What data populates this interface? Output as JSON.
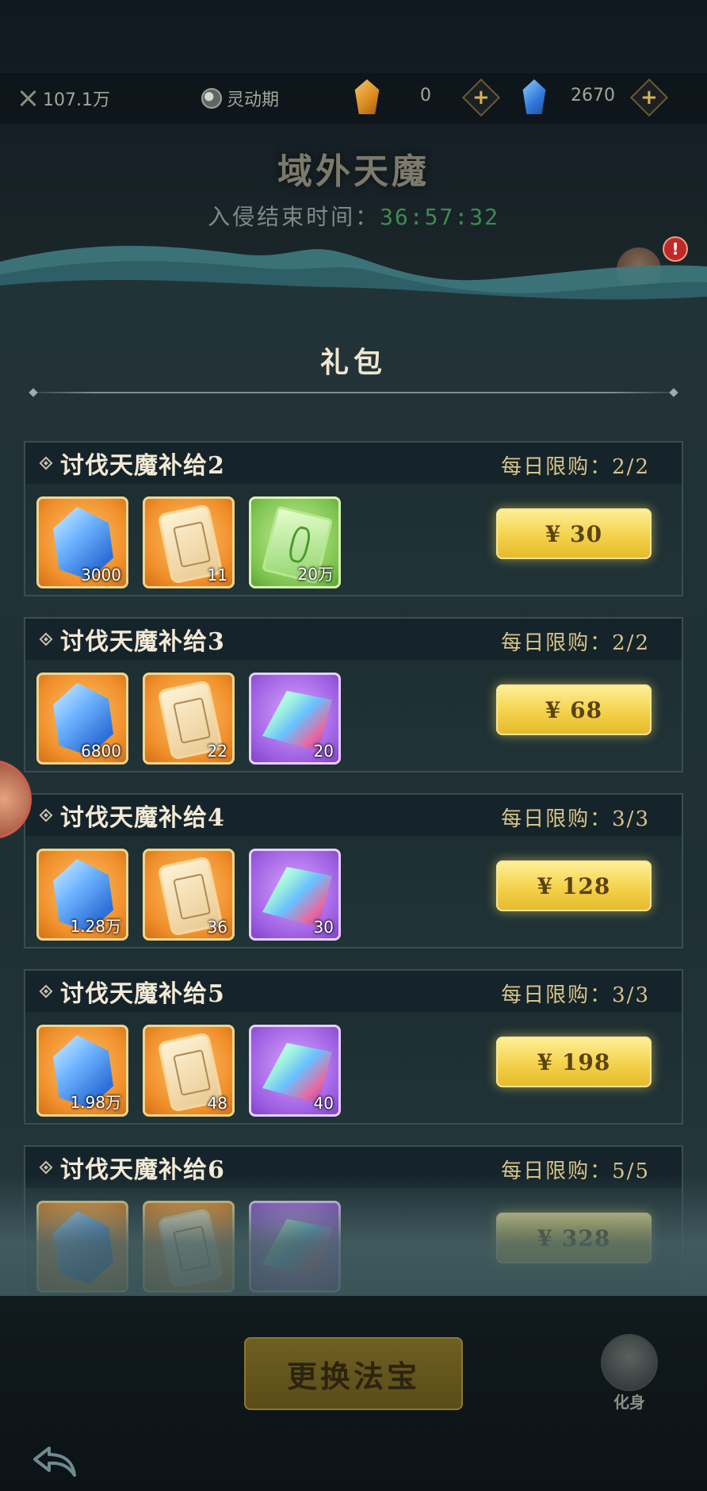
{
  "topbar": {
    "power": "107.1万",
    "realm": "灵动期",
    "orange_gem_count": "0",
    "blue_gem_count": "2670",
    "plus_label": "+"
  },
  "header": {
    "title": "域外天魔",
    "countdown_label": "入侵结束时间：",
    "countdown_time": "36:57:32",
    "alert_badge": "!"
  },
  "panel": {
    "title": "礼包"
  },
  "packages": [
    {
      "name": "讨伐天魔补给2",
      "limit": "每日限购：2/2",
      "price": "¥ 30",
      "items": [
        {
          "kind": "blue-crystal-icon",
          "qty": "3000"
        },
        {
          "kind": "scroll-icon",
          "qty": "11"
        },
        {
          "kind": "jade-token-icon",
          "qty": "20万"
        }
      ]
    },
    {
      "name": "讨伐天魔补给3",
      "limit": "每日限购：2/2",
      "price": "¥ 68",
      "items": [
        {
          "kind": "blue-crystal-icon",
          "qty": "6800"
        },
        {
          "kind": "scroll-icon",
          "qty": "22"
        },
        {
          "kind": "prism-gem-icon",
          "qty": "20"
        }
      ]
    },
    {
      "name": "讨伐天魔补给4",
      "limit": "每日限购：3/3",
      "price": "¥ 128",
      "items": [
        {
          "kind": "blue-crystal-icon",
          "qty": "1.28万"
        },
        {
          "kind": "scroll-icon",
          "qty": "36"
        },
        {
          "kind": "prism-gem-icon",
          "qty": "30"
        }
      ]
    },
    {
      "name": "讨伐天魔补给5",
      "limit": "每日限购：3/3",
      "price": "¥ 198",
      "items": [
        {
          "kind": "blue-crystal-icon",
          "qty": "1.98万"
        },
        {
          "kind": "scroll-icon",
          "qty": "48"
        },
        {
          "kind": "prism-gem-icon",
          "qty": "40"
        }
      ]
    },
    {
      "name": "讨伐天魔补给6",
      "limit": "每日限购：5/5",
      "price": "¥ 328",
      "items": [
        {
          "kind": "blue-crystal-icon",
          "qty": ""
        },
        {
          "kind": "scroll-icon",
          "qty": ""
        },
        {
          "kind": "prism-gem-icon",
          "qty": ""
        }
      ]
    }
  ],
  "bottom": {
    "swap_button": "更换法宝",
    "avatar_label": "化身"
  },
  "colors": {
    "price_button": "#f3d24a",
    "limit_text": "#d9c48a",
    "countdown": "#3f8a50",
    "alert": "#c0292a"
  }
}
